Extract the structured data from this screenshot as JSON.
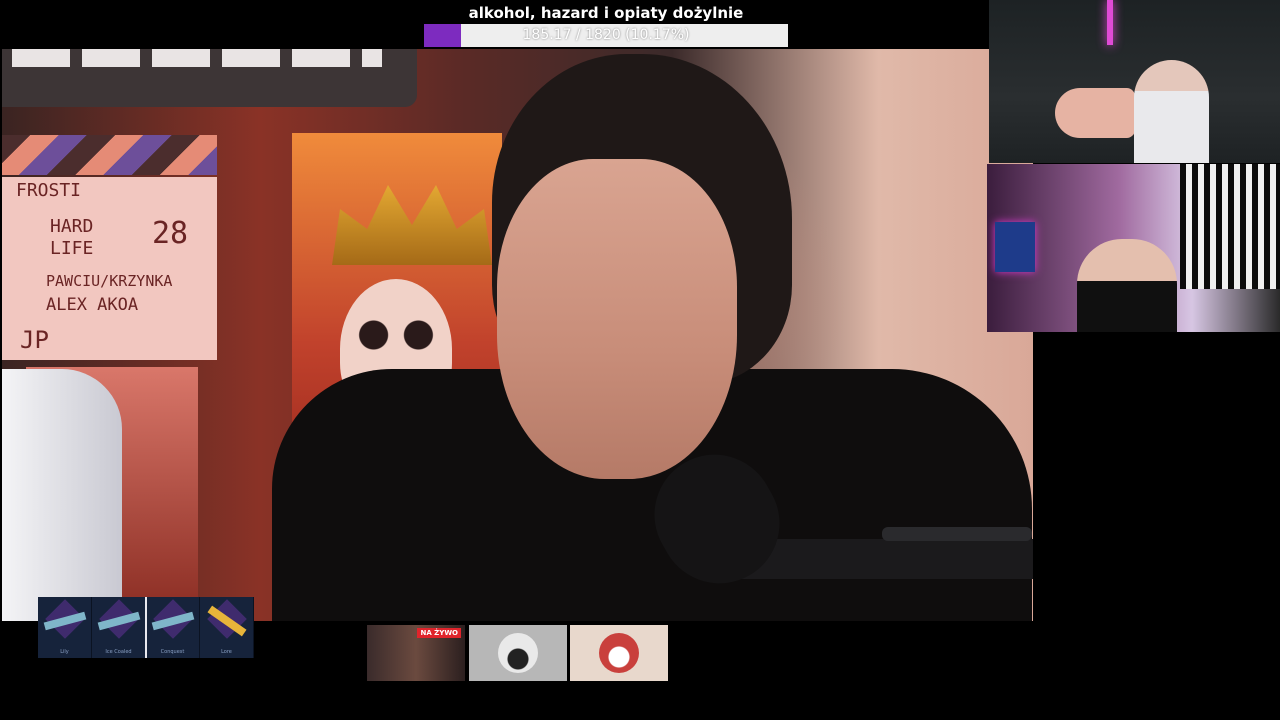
{
  "goal": {
    "title": "alkohol, hazard i opiaty dożylnie",
    "progress_text": "185.17 / 1820 (10.17%)",
    "progress_fraction": 0.1017,
    "fill_color": "#7d2bbf"
  },
  "main_video": {
    "clapperboard": {
      "line1": "FROSTI",
      "line2": "HARD",
      "line3": "LIFE",
      "take": "28",
      "line4": "PAWCIU/KRZYNKA",
      "line5": "ALEX AKOA",
      "initials": "JP"
    }
  },
  "case_strip": {
    "items": [
      {
        "caption": "Lily",
        "icon": "gun-icon"
      },
      {
        "caption": "Ice Coaled",
        "icon": "gun-icon"
      },
      {
        "caption": "Conquest",
        "icon": "gun-icon"
      },
      {
        "caption": "Lore",
        "icon": "knife-icon"
      }
    ]
  },
  "thumbnails": [
    {
      "badge": "NA ŻYWO",
      "icon": "live-stream-thumbnail"
    },
    {
      "icon": "car-avatar-icon"
    },
    {
      "icon": "money-avatar-icon"
    }
  ]
}
